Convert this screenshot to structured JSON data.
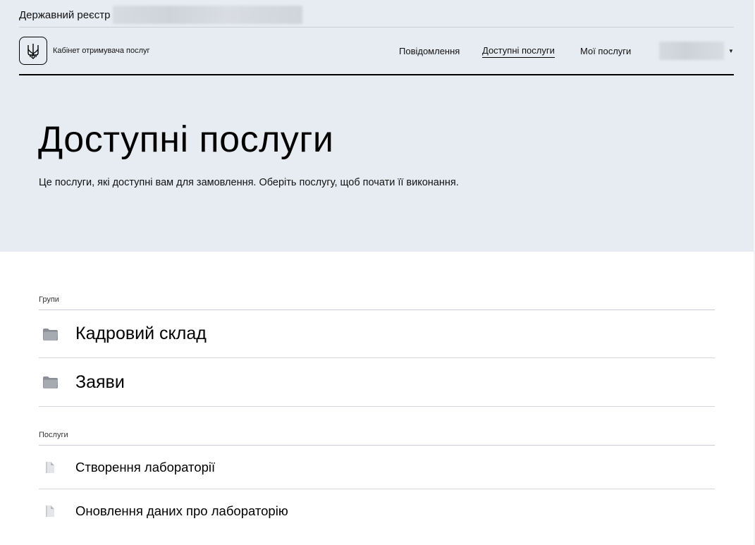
{
  "registry": {
    "title": "Державний реєстр"
  },
  "header": {
    "cabinet_title": "Кабінет отримувача послуг",
    "nav": [
      {
        "label": "Повідомлення",
        "active": false
      },
      {
        "label": "Доступні послуги",
        "active": true
      },
      {
        "label": "Мої послуги",
        "active": false
      }
    ]
  },
  "page": {
    "title": "Доступні послуги",
    "description": "Це послуги, які доступні вам для замовлення. Оберіть послугу, щоб почати її виконання."
  },
  "groups": {
    "label": "Групи",
    "items": [
      {
        "name": "Кадровий склад",
        "icon": "folder-icon"
      },
      {
        "name": "Заяви",
        "icon": "folder-icon"
      }
    ]
  },
  "services": {
    "label": "Послуги",
    "items": [
      {
        "name": "Створення лабораторії",
        "icon": "document-icon"
      },
      {
        "name": "Оновлення даних про лабораторію",
        "icon": "document-icon"
      }
    ]
  },
  "colors": {
    "hero_background": "#e7ecf2",
    "divider": "#d4d7dc"
  }
}
